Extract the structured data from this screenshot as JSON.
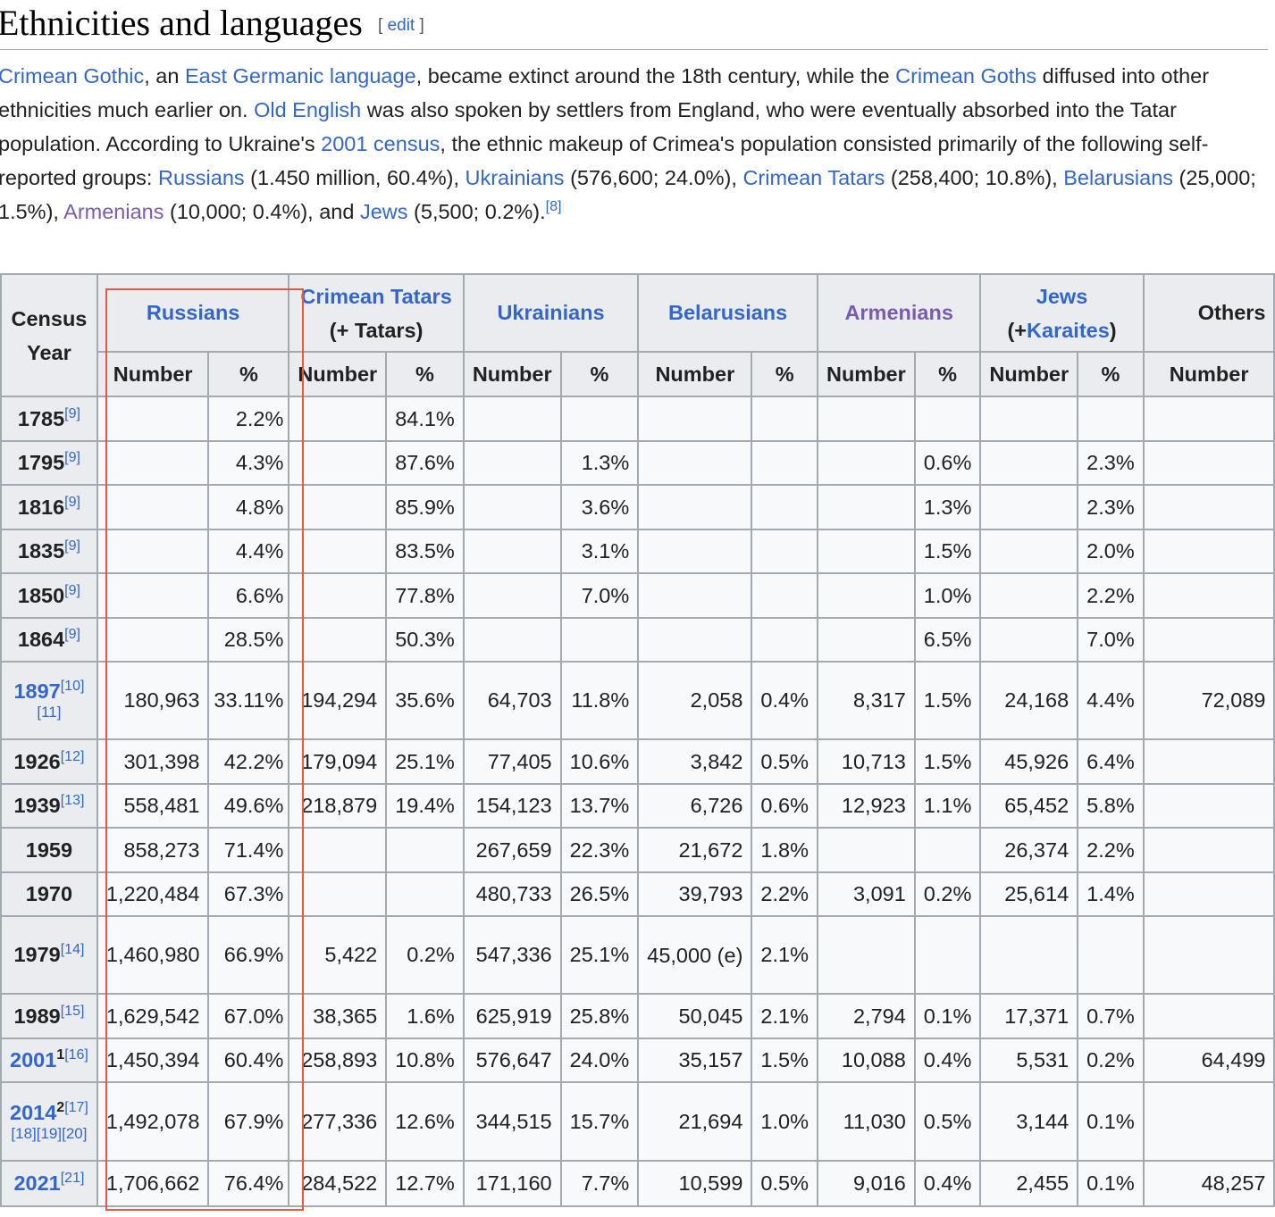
{
  "section": {
    "title": "Ethnicities and languages",
    "edit_label": "edit"
  },
  "paragraph": {
    "link_crimean_gothic": "Crimean Gothic",
    "t1": ", an ",
    "link_east_germanic": "East Germanic language",
    "t2": ", became extinct around the 18th century, while the ",
    "link_crimean_goths": "Crimean Goths",
    "t3": " diffused into other ethnicities much earlier on. ",
    "link_old_english": "Old English",
    "t4": " was also spoken by settlers from England, who were eventually absorbed into the Tatar population. According to Ukraine's ",
    "link_census": "2001 census",
    "t5": ", the ethnic makeup of Crimea's population consisted primarily of the following self-reported groups: ",
    "link_russians": "Russians",
    "t6": " (1.450 million, 60.4%), ",
    "link_ukrainians": "Ukrainians",
    "t7": " (576,600; 24.0%), ",
    "link_crimean_tatars": "Crimean Tatars",
    "t8": " (258,400; 10.8%), ",
    "link_belarusians": "Belarusians",
    "t9": " (25,000; 1.5%), ",
    "link_armenians": "Armenians",
    "t10": " (10,000; 0.4%), and ",
    "link_jews": "Jews",
    "t11": " (5,500; 0.2%).",
    "ref": "[8]"
  },
  "table": {
    "year_header": "Census Year",
    "groups": {
      "russians": "Russians",
      "crimean_tatars": "Crimean Tatars",
      "crimean_tatars_sub": "(+ Tatars)",
      "ukrainians": "Ukrainians",
      "belarusians": "Belarusians",
      "armenians": "Armenians",
      "jews": "Jews",
      "jews_sub_open": "(+",
      "jews_sub_link": "Karaites",
      "jews_sub_close": ")",
      "others": "Others"
    },
    "sub_number": "Number",
    "sub_percent": "%",
    "rows": [
      {
        "year": "1785",
        "ref": "[9]",
        "ref2": "",
        "cells": [
          "",
          "2.2%",
          "",
          "84.1%",
          "",
          "",
          "",
          "",
          "",
          "",
          "",
          "",
          ""
        ]
      },
      {
        "year": "1795",
        "ref": "[9]",
        "ref2": "",
        "cells": [
          "",
          "4.3%",
          "",
          "87.6%",
          "",
          "1.3%",
          "",
          "",
          "",
          "0.6%",
          "",
          "2.3%",
          ""
        ]
      },
      {
        "year": "1816",
        "ref": "[9]",
        "ref2": "",
        "cells": [
          "",
          "4.8%",
          "",
          "85.9%",
          "",
          "3.6%",
          "",
          "",
          "",
          "1.3%",
          "",
          "2.3%",
          ""
        ]
      },
      {
        "year": "1835",
        "ref": "[9]",
        "ref2": "",
        "cells": [
          "",
          "4.4%",
          "",
          "83.5%",
          "",
          "3.1%",
          "",
          "",
          "",
          "1.5%",
          "",
          "2.0%",
          ""
        ]
      },
      {
        "year": "1850",
        "ref": "[9]",
        "ref2": "",
        "cells": [
          "",
          "6.6%",
          "",
          "77.8%",
          "",
          "7.0%",
          "",
          "",
          "",
          "1.0%",
          "",
          "2.2%",
          ""
        ]
      },
      {
        "year": "1864",
        "ref": "[9]",
        "ref2": "",
        "cells": [
          "",
          "28.5%",
          "",
          "50.3%",
          "",
          "",
          "",
          "",
          "",
          "6.5%",
          "",
          "7.0%",
          ""
        ]
      },
      {
        "year": "1897",
        "ref": "[10]",
        "ref2": "[11]",
        "cells": [
          "180,963",
          "33.11%",
          "194,294",
          "35.6%",
          "64,703",
          "11.8%",
          "2,058",
          "0.4%",
          "8,317",
          "1.5%",
          "24,168",
          "4.4%",
          "72,089"
        ]
      },
      {
        "year": "1926",
        "ref": "[12]",
        "ref2": "",
        "cells": [
          "301,398",
          "42.2%",
          "179,094",
          "25.1%",
          "77,405",
          "10.6%",
          "3,842",
          "0.5%",
          "10,713",
          "1.5%",
          "45,926",
          "6.4%",
          ""
        ]
      },
      {
        "year": "1939",
        "ref": "[13]",
        "ref2": "",
        "cells": [
          "558,481",
          "49.6%",
          "218,879",
          "19.4%",
          "154,123",
          "13.7%",
          "6,726",
          "0.6%",
          "12,923",
          "1.1%",
          "65,452",
          "5.8%",
          ""
        ]
      },
      {
        "year": "1959",
        "ref": "",
        "ref2": "",
        "cells": [
          "858,273",
          "71.4%",
          "",
          "",
          "267,659",
          "22.3%",
          "21,672",
          "1.8%",
          "",
          "",
          "26,374",
          "2.2%",
          ""
        ]
      },
      {
        "year": "1970",
        "ref": "",
        "ref2": "",
        "cells": [
          "1,220,484",
          "67.3%",
          "",
          "",
          "480,733",
          "26.5%",
          "39,793",
          "2.2%",
          "3,091",
          "0.2%",
          "25,614",
          "1.4%",
          ""
        ]
      },
      {
        "year": "1979",
        "ref": "[14]",
        "ref2": "",
        "cells": [
          "1,460,980",
          "66.9%",
          "5,422",
          "0.2%",
          "547,336",
          "25.1%",
          "45,000 (e)",
          "2.1%",
          "",
          "",
          "",
          "",
          ""
        ]
      },
      {
        "year": "1989",
        "ref": "[15]",
        "ref2": "",
        "cells": [
          "1,629,542",
          "67.0%",
          "38,365",
          "1.6%",
          "625,919",
          "25.8%",
          "50,045",
          "2.1%",
          "2,794",
          "0.1%",
          "17,371",
          "0.7%",
          ""
        ]
      },
      {
        "year": "2001",
        "note": "1",
        "ref": "[16]",
        "ref2": "",
        "cells": [
          "1,450,394",
          "60.4%",
          "258,893",
          "10.8%",
          "576,647",
          "24.0%",
          "35,157",
          "1.5%",
          "10,088",
          "0.4%",
          "5,531",
          "0.2%",
          "64,499"
        ]
      },
      {
        "year": "2014",
        "note": "2",
        "ref": "[17]",
        "ref2": "[18][19][20]",
        "cells": [
          "1,492,078",
          "67.9%",
          "277,336",
          "12.6%",
          "344,515",
          "15.7%",
          "21,694",
          "1.0%",
          "11,030",
          "0.5%",
          "3,144",
          "0.1%",
          ""
        ]
      },
      {
        "year": "2021",
        "ref": "[21]",
        "ref2": "",
        "cells": [
          "1,706,662",
          "76.4%",
          "284,522",
          "12.7%",
          "171,160",
          "7.7%",
          "10,599",
          "0.5%",
          "9,016",
          "0.4%",
          "2,455",
          "0.1%",
          "48,257"
        ]
      }
    ]
  }
}
